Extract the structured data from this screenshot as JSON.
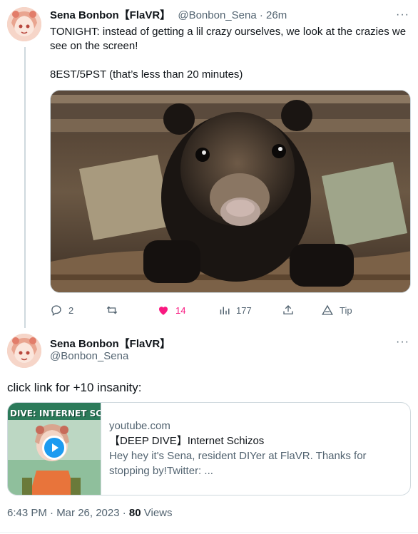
{
  "tweet1": {
    "author_name": "Sena Bonbon【FlaVR】",
    "handle": "@Bonbon_Sena",
    "separator": "·",
    "time": "26m",
    "more": "···",
    "text": "TONIGHT: instead of getting a lil crazy ourselves, we look at the crazies we see on the screen!\n\n8EST/5PST (that’s less than 20 minutes)",
    "actions": {
      "replies": "2",
      "retweets": "",
      "likes": "14",
      "views": "177",
      "share": "",
      "tip": "Tip"
    }
  },
  "tweet2": {
    "author_name": "Sena Bonbon【FlaVR】",
    "handle": "@Bonbon_Sena",
    "more": "···",
    "text": "click link for +10 insanity:",
    "card": {
      "thumb_text": "DIVE: INTERNET SC",
      "domain": "youtube.com",
      "title": "【DEEP DIVE】Internet Schizos",
      "description": "Hey hey it's Sena, resident DIYer at FlaVR. Thanks for stopping by!Twitter: ..."
    },
    "timestamp": "6:43 PM · Mar 26, 2023 · ",
    "views_count": "80",
    "views_label": " Views"
  },
  "colors": {
    "like": "#f91880",
    "muted": "#536471",
    "border": "#cfd9de",
    "play": "#1d9bf0"
  },
  "icons": [
    "reply-icon",
    "retweet-icon",
    "heart-icon",
    "views-icon",
    "share-icon",
    "tip-icon",
    "play-icon"
  ]
}
